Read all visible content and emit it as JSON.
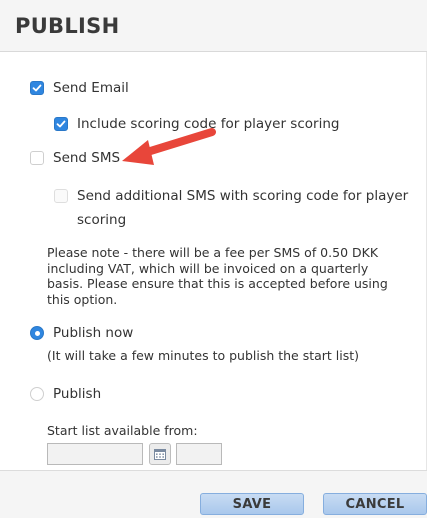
{
  "header": {
    "title": "PUBLISH"
  },
  "options": {
    "send_email": {
      "label": "Send Email",
      "checked": true
    },
    "include_scoring": {
      "label": "Include scoring code for player scoring",
      "checked": true
    },
    "send_sms": {
      "label": "Send SMS",
      "checked": false
    },
    "additional_sms": {
      "label_line1": "Send additional SMS with scoring code for player",
      "label_line2": "scoring",
      "checked": false,
      "disabled": true
    }
  },
  "note": "Please note - there will be a fee per SMS of 0.50 DKK including VAT, which will be invoiced on a quarterly basis. Please ensure that this is accepted before using this option.",
  "publish_now": {
    "label": "Publish now",
    "selected": true,
    "subtext": "(It will take a few minutes to publish the start list)"
  },
  "publish": {
    "label": "Publish",
    "selected": false
  },
  "start_list": {
    "label": "Start list available from:",
    "date_value": "",
    "time_value": ""
  },
  "footer": {
    "save_label": "SAVE",
    "cancel_label": "CANCEL"
  },
  "colors": {
    "accent": "#2f86e0",
    "arrow": "#e8463a",
    "button": "#b4cff0"
  },
  "icons": {
    "calendar": "calendar-icon",
    "annotation": "red-arrow-icon"
  }
}
